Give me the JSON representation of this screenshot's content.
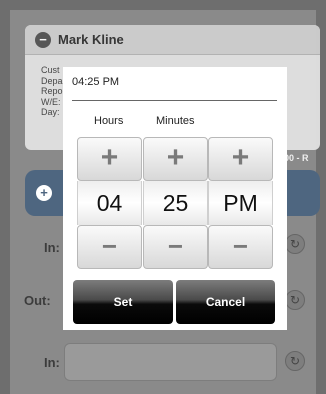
{
  "background": {
    "employee_name": "Mark Kline",
    "detail_lines": [
      "Cust",
      "Depa",
      "Repo",
      "W/E:",
      "Day:"
    ],
    "right_tag": "00 - R",
    "row_labels": [
      "In:",
      "Out:",
      "In:"
    ],
    "collapse_icon": "minus-circle-icon",
    "add_icon": "plus-circle-icon",
    "row_button_icon": "refresh-icon"
  },
  "dialog": {
    "time_display": "04:25 PM",
    "hours_label": "Hours",
    "minutes_label": "Minutes",
    "hours_value": "04",
    "minutes_value": "25",
    "ampm_value": "PM",
    "increment_symbol": "+",
    "decrement_symbol": "−",
    "set_label": "Set",
    "cancel_label": "Cancel"
  },
  "colors": {
    "overlay": "#6e6e6e",
    "card": "#e2e2e2",
    "accent_bar": "#4e6680",
    "dialog": "#ffffff",
    "button_dark": "#000000"
  }
}
